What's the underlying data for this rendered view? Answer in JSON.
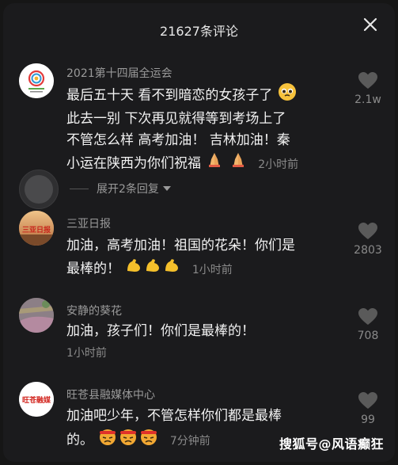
{
  "header": {
    "title": "21627条评论",
    "close_icon": "close-icon"
  },
  "comments": [
    {
      "author": "2021第十四届全运会",
      "lines": [
        "最后五十天 看不到暗恋的女孩子了",
        "此去一别 下次再见就得等到考场上了",
        "不管怎么样 高考加油！ 吉林加油！秦",
        "小运在陕西为你们祝福"
      ],
      "time": "2小时前",
      "likes": "2.1w",
      "reply_toggle": "展开2条回复"
    },
    {
      "author": "三亚日报",
      "lines": [
        "加油，高考加油！祖国的花朵！你们是",
        "最棒的！"
      ],
      "time": "1小时前",
      "likes": "2803",
      "avatar_text": "三亚日报"
    },
    {
      "author": "安静的葵花",
      "lines": [
        "加油，孩子们！你们是最棒的！"
      ],
      "time": "1小时前",
      "likes": "708"
    },
    {
      "author": "旺苍县融媒体中心",
      "lines": [
        "加油吧少年，不管怎样你们都是最棒",
        "的。"
      ],
      "time": "7分钟前",
      "likes": "99",
      "avatar_text": "旺苍融媒"
    }
  ],
  "watermark": "搜狐号@风语癫狂",
  "colors": {
    "background": "#1b1b1d",
    "text": "#f2f2f2",
    "meta": "#8a8a8a",
    "heart": "#5a5a5a"
  }
}
